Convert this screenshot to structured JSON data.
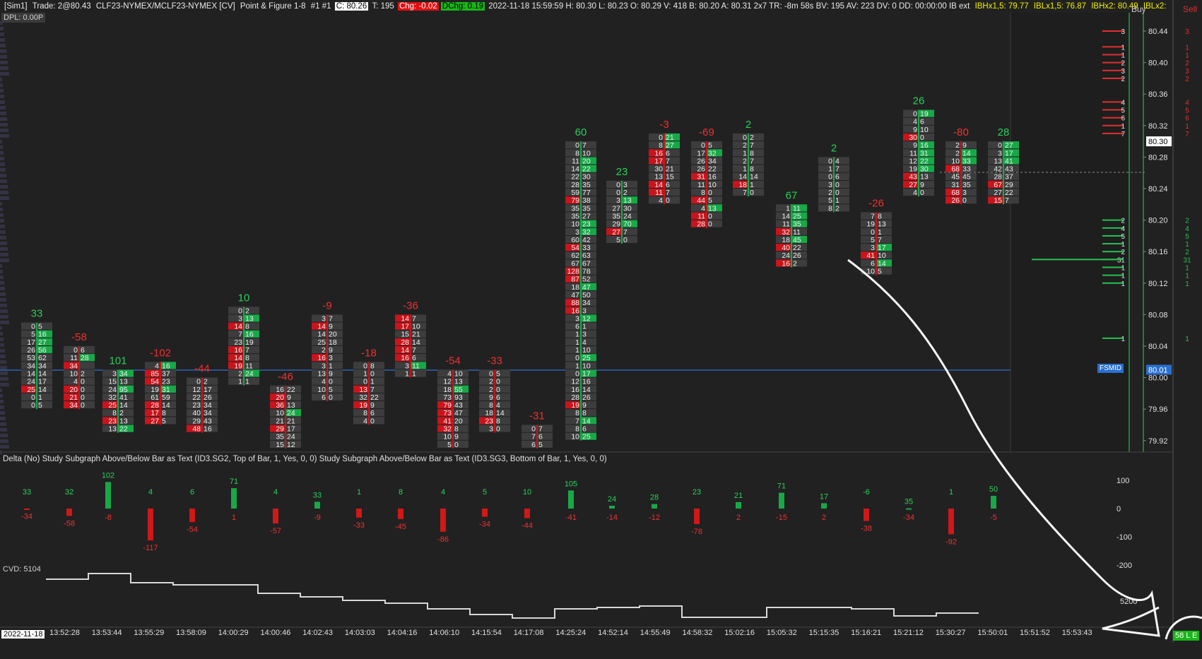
{
  "header": {
    "sim": "[Sim1]",
    "trade": "Trade: 2@80.43",
    "symbol": "CLF23-NYMEX/MCLF23-NYMEX [CV]",
    "chart_type": "Point & Figure 1-8",
    "chart_num": "#1 #1",
    "close": "C: 80.26",
    "ticks": "T: 195",
    "chg": "Chg: -0.02",
    "dchg": "DChg: 0.19",
    "info": "2022-11-18 15:59:59 H: 80.30 L: 80.23 O: 80.29 V: 418 B: 80.20 A: 80.31 2x7 TR: -8m 58s BV: 195 AV: 223 DV: 0 DD: 00:00:00 IB ext",
    "ibh1": "IBHx1,5: 79.77",
    "ibl1": "IBLx1,5: 76.87",
    "ibh2": "IBHx2: 80.49",
    "ibl2": "IBLx2:"
  },
  "dpl": "DPL: 0.00P",
  "dom": {
    "buy_label": "Buy",
    "sell_label": "Sell"
  },
  "price_axis": {
    "ticks": [
      "80.44",
      "80.40",
      "80.36",
      "80.32",
      "80.28",
      "80.24",
      "80.20",
      "80.16",
      "80.12",
      "80.08",
      "80.04",
      "80.00",
      "79.96",
      "79.92"
    ],
    "current_price": "80.30",
    "fsmid_label": "FSMID",
    "fsmid_price": "80.01"
  },
  "study": {
    "title": "Delta   (No)  Study Subgraph Above/Below Bar as Text   (ID3.SG2, Top of Bar, 1, Yes, 0, 0)  Study Subgraph Above/Below Bar as Text   (ID3.SG3, Bottom of Bar, 1, Yes, 0, 0)",
    "axis_ticks": [
      "100",
      "0",
      "-100",
      "-200"
    ],
    "cvd_label": "CVD: 5104",
    "cvd_axis_tick": "5200"
  },
  "time_axis": {
    "date": "2022-11-18",
    "ticks": [
      "13:52:28",
      "13:53:44",
      "13:55:29",
      "13:58:09",
      "14:00:29",
      "14:00:46",
      "14:02:43",
      "14:03:03",
      "14:04:16",
      "14:06:10",
      "14:15:54",
      "14:17:08",
      "14:25:24",
      "14:52:14",
      "14:55:49",
      "14:58:32",
      "15:02:16",
      "15:05:32",
      "15:15:35",
      "15:16:21",
      "15:21:12",
      "15:30:27",
      "15:50:01",
      "15:51:52",
      "15:53:43"
    ]
  },
  "status_badge": "58 L E",
  "colors": {
    "bg": "#212121",
    "up": "#18b84a",
    "down": "#d01818",
    "blue": "#3b82f6",
    "fsmid": "#2a6fd0"
  },
  "chart_data": {
    "type": "table",
    "footprint_bars": [
      {
        "delta": "33",
        "rows": [
          [
            "0",
            "5"
          ],
          [
            "5",
            "16"
          ],
          [
            "17",
            "27"
          ],
          [
            "26",
            "56"
          ],
          [
            "53",
            "62"
          ],
          [
            "34",
            "34"
          ],
          [
            "14",
            "14"
          ],
          [
            "24",
            "17"
          ],
          [
            "25",
            "14"
          ],
          [
            "0",
            "1"
          ],
          [
            "0",
            "5"
          ]
        ]
      },
      {
        "delta": "-58",
        "rows": [
          [
            "0",
            "6"
          ],
          [
            "11",
            "28"
          ],
          [
            "34",
            ""
          ],
          [
            "10",
            "2"
          ],
          [
            "4",
            "0"
          ],
          [
            "20",
            "0"
          ],
          [
            "21",
            "0"
          ],
          [
            "34",
            "0"
          ]
        ]
      },
      {
        "delta": "101",
        "rows": [
          [
            "3",
            "34"
          ],
          [
            "15",
            "13"
          ],
          [
            "24",
            "95"
          ],
          [
            "32",
            "41"
          ],
          [
            "25",
            "14"
          ],
          [
            "8",
            "2"
          ],
          [
            "23",
            "13"
          ],
          [
            "13",
            "22"
          ]
        ]
      },
      {
        "delta": "-102",
        "rows": [
          [
            "4",
            "16"
          ],
          [
            "85",
            "37"
          ],
          [
            "54",
            "23"
          ],
          [
            "19",
            "31"
          ],
          [
            "61",
            "59"
          ],
          [
            "28",
            "14"
          ],
          [
            "17",
            "8"
          ],
          [
            "27",
            "5"
          ]
        ]
      },
      {
        "delta": "-44",
        "rows": [
          [
            "0",
            "2"
          ],
          [
            "12",
            "17"
          ],
          [
            "22",
            "26"
          ],
          [
            "23",
            "34"
          ],
          [
            "40",
            "34"
          ],
          [
            "29",
            "43"
          ],
          [
            "48",
            "16"
          ]
        ]
      },
      {
        "delta": "10",
        "rows": [
          [
            "0",
            "2"
          ],
          [
            "3",
            "13"
          ],
          [
            "14",
            "8"
          ],
          [
            "7",
            "16"
          ],
          [
            "23",
            "19"
          ],
          [
            "16",
            "7"
          ],
          [
            "14",
            "8"
          ],
          [
            "19",
            "11"
          ],
          [
            "2",
            "24"
          ],
          [
            "1",
            "1"
          ]
        ]
      },
      {
        "delta": "-46",
        "rows": [
          [
            "16",
            "22"
          ],
          [
            "20",
            "9"
          ],
          [
            "36",
            "13"
          ],
          [
            "10",
            "24"
          ],
          [
            "21",
            "21"
          ],
          [
            "29",
            "17"
          ],
          [
            "35",
            "24"
          ],
          [
            "15",
            "12"
          ]
        ]
      },
      {
        "delta": "-9",
        "rows": [
          [
            "3",
            "7"
          ],
          [
            "14",
            "9"
          ],
          [
            "14",
            "20"
          ],
          [
            "25",
            "18"
          ],
          [
            "2",
            "9"
          ],
          [
            "16",
            "3"
          ],
          [
            "3",
            "1"
          ],
          [
            "13",
            "9"
          ],
          [
            "4",
            "0"
          ],
          [
            "10",
            "5"
          ],
          [
            "6",
            "0"
          ]
        ]
      },
      {
        "delta": "-18",
        "rows": [
          [
            "0",
            "8"
          ],
          [
            "1",
            "0"
          ],
          [
            "0",
            "1"
          ],
          [
            "13",
            "7"
          ],
          [
            "32",
            "22"
          ],
          [
            "19",
            "9"
          ],
          [
            "8",
            "6"
          ],
          [
            "4",
            "0"
          ]
        ]
      },
      {
        "delta": "-36",
        "rows": [
          [
            "14",
            "7"
          ],
          [
            "17",
            "10"
          ],
          [
            "15",
            "21"
          ],
          [
            "28",
            "14"
          ],
          [
            "14",
            "7"
          ],
          [
            "16",
            "6"
          ],
          [
            "3",
            "11"
          ],
          [
            "1",
            "1"
          ]
        ]
      },
      {
        "delta": "-54",
        "rows": [
          [
            "4",
            "10"
          ],
          [
            "12",
            "13"
          ],
          [
            "18",
            "55"
          ],
          [
            "73",
            "93"
          ],
          [
            "79",
            "43"
          ],
          [
            "73",
            "47"
          ],
          [
            "41",
            "20"
          ],
          [
            "32",
            "8"
          ],
          [
            "10",
            "9"
          ],
          [
            "5",
            "0"
          ]
        ]
      },
      {
        "delta": "-33",
        "rows": [
          [
            "0",
            "5"
          ],
          [
            "2",
            "0"
          ],
          [
            "2",
            "0"
          ],
          [
            "9",
            "6"
          ],
          [
            "8",
            "4"
          ],
          [
            "18",
            "14"
          ],
          [
            "23",
            "8"
          ],
          [
            "3",
            "0"
          ]
        ]
      },
      {
        "delta": "-31",
        "rows": [
          [
            "0",
            "7"
          ],
          [
            "7",
            "6"
          ],
          [
            "6",
            "5"
          ]
        ]
      },
      {
        "delta": "60",
        "rows": [
          [
            "0",
            "7"
          ],
          [
            "8",
            "10"
          ],
          [
            "11",
            "20"
          ],
          [
            "14",
            "22"
          ],
          [
            "22",
            "30"
          ],
          [
            "28",
            "35"
          ],
          [
            "59",
            "77"
          ],
          [
            "79",
            "38"
          ],
          [
            "35",
            "35"
          ],
          [
            "35",
            "27"
          ],
          [
            "10",
            "23"
          ],
          [
            "3",
            "32"
          ],
          [
            "60",
            "42"
          ],
          [
            "54",
            "33"
          ],
          [
            "62",
            "63"
          ],
          [
            "67",
            "67"
          ],
          [
            "128",
            "78"
          ],
          [
            "87",
            "52"
          ],
          [
            "18",
            "47"
          ],
          [
            "47",
            "50"
          ],
          [
            "88",
            "34"
          ],
          [
            "16",
            "3"
          ],
          [
            "3",
            "12"
          ],
          [
            "6",
            "1"
          ],
          [
            "1",
            "3"
          ],
          [
            "1",
            "4"
          ],
          [
            "1",
            "10"
          ],
          [
            "0",
            "25"
          ],
          [
            "1",
            "10"
          ],
          [
            "0",
            "17"
          ],
          [
            "12",
            "16"
          ],
          [
            "16",
            "14"
          ],
          [
            "28",
            "26"
          ],
          [
            "19",
            "9"
          ],
          [
            "8",
            "8"
          ],
          [
            "7",
            "14"
          ],
          [
            "8",
            "6"
          ],
          [
            "10",
            "25"
          ]
        ]
      },
      {
        "delta": "23",
        "rows": [
          [
            "0",
            "3"
          ],
          [
            "0",
            "2"
          ],
          [
            "3",
            "13"
          ],
          [
            "27",
            "30"
          ],
          [
            "35",
            "24"
          ],
          [
            "29",
            "70"
          ],
          [
            "27",
            "7"
          ],
          [
            "5",
            "0"
          ]
        ]
      },
      {
        "delta": "-3",
        "rows": [
          [
            "0",
            "21"
          ],
          [
            "8",
            "27"
          ],
          [
            "16",
            "6"
          ],
          [
            "17",
            "7"
          ],
          [
            "30",
            "21"
          ],
          [
            "13",
            "15"
          ],
          [
            "14",
            "6"
          ],
          [
            "11",
            "7"
          ],
          [
            "4",
            "0"
          ]
        ]
      },
      {
        "delta": "-69",
        "rows": [
          [
            "0",
            "5"
          ],
          [
            "17",
            "32"
          ],
          [
            "26",
            "34"
          ],
          [
            "26",
            "22"
          ],
          [
            "31",
            "16"
          ],
          [
            "11",
            "10"
          ],
          [
            "8",
            "0"
          ],
          [
            "44",
            "5"
          ],
          [
            "4",
            "13"
          ],
          [
            "11",
            "0"
          ],
          [
            "28",
            "0"
          ]
        ]
      },
      {
        "delta": "2",
        "rows": [
          [
            "0",
            "2"
          ],
          [
            "2",
            "7"
          ],
          [
            "1",
            "8"
          ],
          [
            "2",
            "7"
          ],
          [
            "1",
            "8"
          ],
          [
            "14",
            "14"
          ],
          [
            "18",
            "1"
          ],
          [
            "7",
            "0"
          ]
        ]
      },
      {
        "delta": "67",
        "rows": [
          [
            "1",
            "11"
          ],
          [
            "14",
            "25"
          ],
          [
            "11",
            "35"
          ],
          [
            "32",
            "11"
          ],
          [
            "18",
            "45"
          ],
          [
            "40",
            "22"
          ],
          [
            "24",
            "26"
          ],
          [
            "16",
            "2"
          ]
        ]
      },
      {
        "delta": "2",
        "rows": [
          [
            "0",
            "4"
          ],
          [
            "1",
            "7"
          ],
          [
            "0",
            "6"
          ],
          [
            "3",
            "0"
          ],
          [
            "2",
            "0"
          ],
          [
            "5",
            "1"
          ],
          [
            "8",
            "2"
          ]
        ]
      },
      {
        "delta": "-26",
        "rows": [
          [
            "7",
            "8"
          ],
          [
            "19",
            "13"
          ],
          [
            "0",
            "1"
          ],
          [
            "5",
            "7"
          ],
          [
            "3",
            "17"
          ],
          [
            "41",
            "10"
          ],
          [
            "6",
            "14"
          ],
          [
            "10",
            "5"
          ]
        ]
      },
      {
        "delta": "26",
        "rows": [
          [
            "0",
            "19"
          ],
          [
            "4",
            "6"
          ],
          [
            "9",
            "10"
          ],
          [
            "30",
            "0"
          ],
          [
            "9",
            "16"
          ],
          [
            "11",
            "31"
          ],
          [
            "12",
            "22"
          ],
          [
            "19",
            "30"
          ],
          [
            "43",
            "13"
          ],
          [
            "27",
            "9"
          ],
          [
            "4",
            "0"
          ]
        ]
      },
      {
        "delta": "-80",
        "rows": [
          [
            "2",
            "9"
          ],
          [
            "2",
            "14"
          ],
          [
            "10",
            "33"
          ],
          [
            "68",
            "33"
          ],
          [
            "45",
            "45"
          ],
          [
            "31",
            "35"
          ],
          [
            "68",
            "3"
          ],
          [
            "26",
            "0"
          ]
        ]
      },
      {
        "delta": "28",
        "rows": [
          [
            "0",
            "27"
          ],
          [
            "3",
            "17"
          ],
          [
            "13",
            "41"
          ],
          [
            "42",
            "43"
          ],
          [
            "28",
            "37"
          ],
          [
            "67",
            "29"
          ],
          [
            "27",
            "22"
          ],
          [
            "15",
            "7"
          ]
        ]
      }
    ],
    "delta_study": {
      "type": "bar",
      "ylim": [
        -200,
        150
      ],
      "top_labels": [
        "33",
        "32",
        "102",
        "4",
        "6",
        "71",
        "4",
        "33",
        "1",
        "8",
        "4",
        "5",
        "10",
        "105",
        "24",
        "28",
        "23",
        "21",
        "71",
        "17",
        "-6",
        "35",
        "1",
        "50"
      ],
      "bottom_labels": [
        "-34",
        "-58",
        "-8",
        "-117",
        "-54",
        "1",
        "-57",
        "-9",
        "-33",
        "-45",
        "-86",
        "-34",
        "-44",
        "-41",
        "-14",
        "-12",
        "-78",
        "2",
        "-15",
        "2",
        "-38",
        "-34",
        "-92",
        "-5"
      ],
      "values": [
        -1,
        -26,
        94,
        -113,
        -48,
        72,
        -53,
        24,
        -32,
        -37,
        -82,
        -29,
        -34,
        64,
        10,
        16,
        -55,
        23,
        56,
        19,
        -44,
        1,
        -91,
        45
      ]
    }
  }
}
